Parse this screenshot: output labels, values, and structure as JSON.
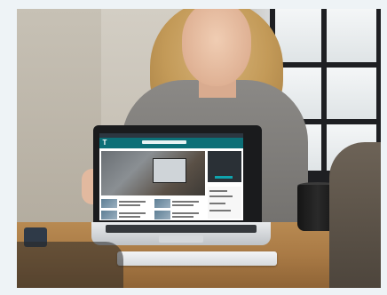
{
  "photo": {
    "subject": "",
    "colors": {
      "background_frame": "#eef3f6",
      "table_wood": "#a97a45",
      "sweater": "#7a7875",
      "site_header_teal": "#0c6f77",
      "laptop_lid": "#1a1b1d"
    }
  },
  "laptop_screen": {
    "logo_glyph": "T"
  }
}
